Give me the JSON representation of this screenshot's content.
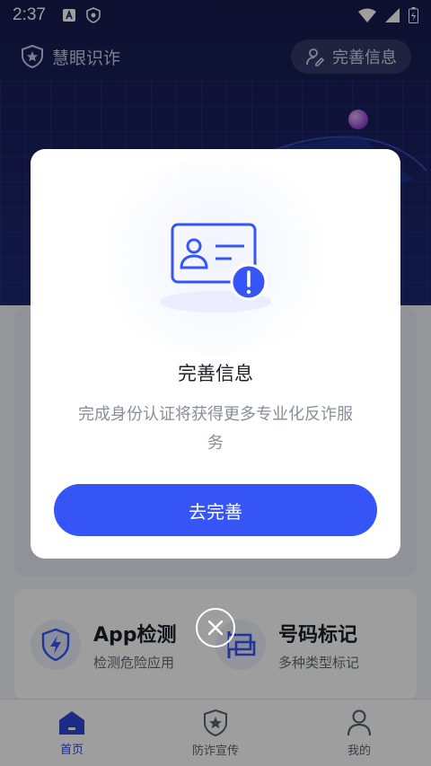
{
  "status_bar": {
    "time": "2:37"
  },
  "header": {
    "brand": "慧眼识诈",
    "profile_button": "完善信息"
  },
  "features": [
    {
      "title": "App检测",
      "subtitle": "检测危险应用",
      "icon": "shield-bolt-icon"
    },
    {
      "title": "号码标记",
      "subtitle": "多种类型标记",
      "icon": "flag-icon"
    }
  ],
  "nav": [
    {
      "label": "首页",
      "icon": "home-icon",
      "active": true
    },
    {
      "label": "防诈宣传",
      "icon": "badge-star-icon",
      "active": false
    },
    {
      "label": "我的",
      "icon": "person-icon",
      "active": false
    }
  ],
  "dialog": {
    "title": "完善信息",
    "text": "完成身份认证将获得更多专业化反诈服务",
    "button": "去完善"
  },
  "colors": {
    "accent": "#3655f6",
    "hero": "#1b2366",
    "nav_active": "#2d48d8"
  }
}
